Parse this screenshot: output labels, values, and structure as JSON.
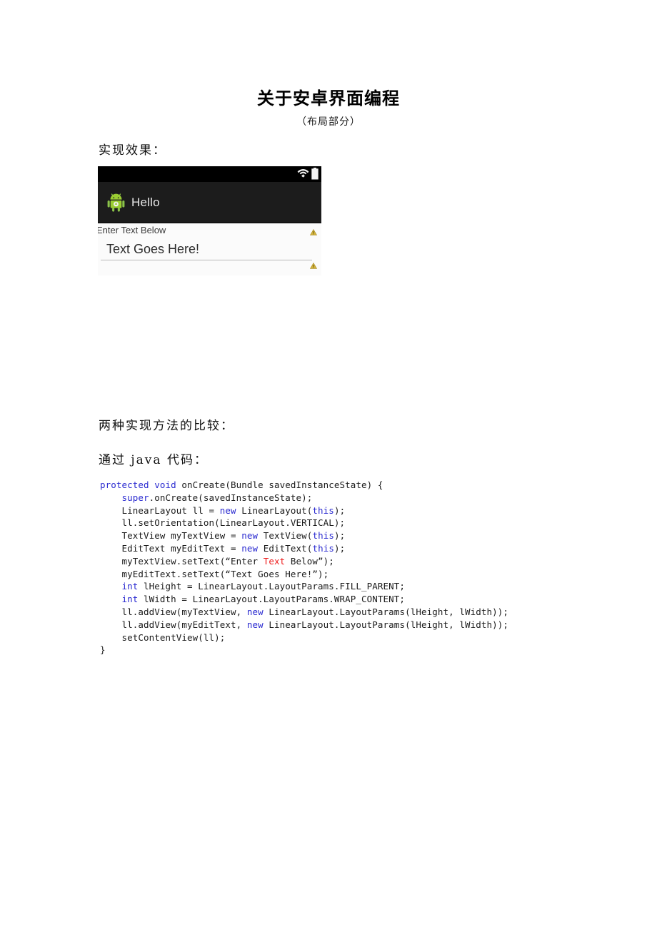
{
  "document": {
    "title": "关于安卓界面编程",
    "subtitle": "（布局部分）",
    "sections": {
      "result_heading": "实现效果：",
      "compare_heading": "两种实现方法的比较：",
      "java_heading": "通过 java 代码："
    }
  },
  "figure": {
    "name": "android-app-screenshot",
    "status_bar": {
      "wifi_icon": "wifi-icon",
      "battery_icon": "battery-icon",
      "background": "#000000"
    },
    "app_bar": {
      "icon": "android-robot-icon",
      "title": "Hello",
      "background": "#1c1c1c",
      "text_color": "#e8e8e8"
    },
    "content": {
      "textview_label": "Enter Text Below",
      "edittext_value": "Text Goes Here!",
      "warning_icon": "warning-triangle-icon",
      "warning_color": "#c9a227",
      "background": "#fbfbfb"
    }
  },
  "code": {
    "language": "java",
    "keyword_color": "#2a2ad0",
    "highlight_color": "#ee1c1c",
    "lines": [
      {
        "id": "line-1",
        "parts": [
          {
            "t": "protected void",
            "c": "kw"
          },
          {
            "t": " onCreate(Bundle savedInstanceState) {",
            "c": ""
          }
        ]
      },
      {
        "id": "line-2",
        "parts": [
          {
            "t": "    ",
            "c": ""
          },
          {
            "t": "super",
            "c": "kw"
          },
          {
            "t": ".onCreate(savedInstanceState);",
            "c": ""
          }
        ]
      },
      {
        "id": "line-3",
        "parts": [
          {
            "t": "    LinearLayout ll = ",
            "c": ""
          },
          {
            "t": "new",
            "c": "kw"
          },
          {
            "t": " LinearLayout(",
            "c": ""
          },
          {
            "t": "this",
            "c": "kw"
          },
          {
            "t": ");",
            "c": ""
          }
        ]
      },
      {
        "id": "line-4",
        "parts": [
          {
            "t": "    ll.setOrientation(LinearLayout.VERTICAL);",
            "c": ""
          }
        ]
      },
      {
        "id": "line-5",
        "parts": [
          {
            "t": "    TextView myTextView = ",
            "c": ""
          },
          {
            "t": "new",
            "c": "kw"
          },
          {
            "t": " TextView(",
            "c": ""
          },
          {
            "t": "this",
            "c": "kw"
          },
          {
            "t": ");",
            "c": ""
          }
        ]
      },
      {
        "id": "line-6",
        "parts": [
          {
            "t": "    EditText myEditText = ",
            "c": ""
          },
          {
            "t": "new",
            "c": "kw"
          },
          {
            "t": " EditText(",
            "c": ""
          },
          {
            "t": "this",
            "c": "kw"
          },
          {
            "t": ");",
            "c": ""
          }
        ]
      },
      {
        "id": "line-7",
        "parts": [
          {
            "t": "    myTextView.setText(“Enter ",
            "c": ""
          },
          {
            "t": "Text",
            "c": "str-hl"
          },
          {
            "t": " Below”);",
            "c": ""
          }
        ]
      },
      {
        "id": "line-8",
        "parts": [
          {
            "t": "    myEditText.setText(“Text Goes Here!”);",
            "c": ""
          }
        ]
      },
      {
        "id": "line-9",
        "parts": [
          {
            "t": "    ",
            "c": ""
          },
          {
            "t": "int",
            "c": "kw"
          },
          {
            "t": " lHeight = LinearLayout.LayoutParams.FILL_PARENT;",
            "c": ""
          }
        ]
      },
      {
        "id": "line-10",
        "parts": [
          {
            "t": "    ",
            "c": ""
          },
          {
            "t": "int",
            "c": "kw"
          },
          {
            "t": " lWidth = LinearLayout.LayoutParams.WRAP_CONTENT;",
            "c": ""
          }
        ]
      },
      {
        "id": "line-11",
        "parts": [
          {
            "t": "    ll.addView(myTextView, ",
            "c": ""
          },
          {
            "t": "new",
            "c": "kw"
          },
          {
            "t": " LinearLayout.LayoutParams(lHeight, lWidth));",
            "c": ""
          }
        ]
      },
      {
        "id": "line-12",
        "parts": [
          {
            "t": "    ll.addView(myEditText, ",
            "c": ""
          },
          {
            "t": "new",
            "c": "kw"
          },
          {
            "t": " LinearLayout.LayoutParams(lHeight, lWidth));",
            "c": ""
          }
        ]
      },
      {
        "id": "line-13",
        "parts": [
          {
            "t": "    setContentView(ll);",
            "c": ""
          }
        ]
      },
      {
        "id": "line-14",
        "parts": [
          {
            "t": "}",
            "c": ""
          }
        ]
      }
    ]
  }
}
